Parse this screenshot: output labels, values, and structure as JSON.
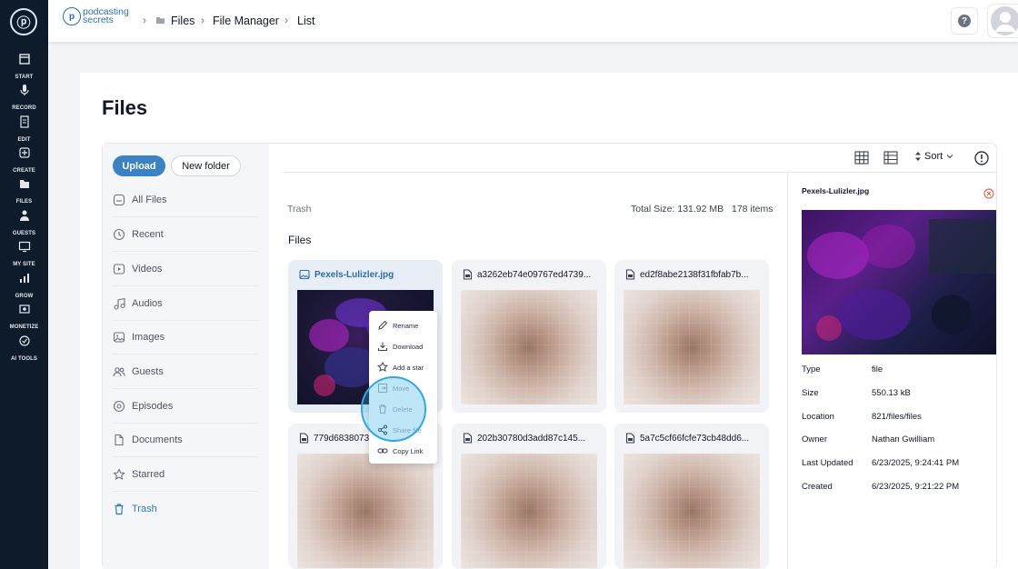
{
  "rail": {
    "items": [
      {
        "label": "START",
        "icon": "start-icon"
      },
      {
        "label": "RECORD",
        "icon": "microphone-icon"
      },
      {
        "label": "EDIT",
        "icon": "edit-icon"
      },
      {
        "label": "CREATE",
        "icon": "create-icon"
      },
      {
        "label": "FILES",
        "icon": "files-icon"
      },
      {
        "label": "GUESTS",
        "icon": "guests-icon"
      },
      {
        "label": "MY SITE",
        "icon": "site-icon"
      },
      {
        "label": "GROW",
        "icon": "grow-icon"
      },
      {
        "label": "MONETIZE",
        "icon": "monetize-icon"
      },
      {
        "label": "AI TOOLS",
        "icon": "ai-tools-icon"
      }
    ]
  },
  "header": {
    "brand_line1": "podcasting",
    "brand_line2": "secrets",
    "breadcrumb": [
      "Files",
      "File Manager",
      "List"
    ],
    "help_glyph": "?"
  },
  "page": {
    "title": "Files"
  },
  "actions": {
    "upload": "Upload",
    "new_folder": "New folder"
  },
  "nav": {
    "items": [
      {
        "label": "All Files"
      },
      {
        "label": "Recent"
      },
      {
        "label": "Videos"
      },
      {
        "label": "Audios"
      },
      {
        "label": "Images"
      },
      {
        "label": "Guests"
      },
      {
        "label": "Episodes"
      },
      {
        "label": "Documents"
      },
      {
        "label": "Starred"
      },
      {
        "label": "Trash"
      }
    ],
    "active": "Trash",
    "accent_color": "#2b7bb9"
  },
  "toolbar": {
    "sort_label": "Sort"
  },
  "listing": {
    "location_label": "Trash",
    "total_size": "Total Size: 131.92 MB",
    "item_count": "178 items",
    "section_title": "Files"
  },
  "files": [
    {
      "name": "Pexels-Lulizler.jpg",
      "type": "image"
    },
    {
      "name": "a3262eb74e09767ed4739...",
      "type": "document"
    },
    {
      "name": "ed2f8abe2138f31fbfab7b...",
      "type": "document"
    },
    {
      "name": "779d6838073",
      "type": "document"
    },
    {
      "name": "202b30780d3add87c145...",
      "type": "document"
    },
    {
      "name": "5a7c5cf66fcfe73cb48dd6...",
      "type": "document"
    }
  ],
  "context_menu": {
    "items": [
      {
        "label": "Rename",
        "icon": "pencil-icon"
      },
      {
        "label": "Download",
        "icon": "download-icon"
      },
      {
        "label": "Add a star",
        "icon": "star-icon"
      },
      {
        "label": "Move",
        "icon": "move-icon"
      },
      {
        "label": "Delete",
        "icon": "trash-icon"
      },
      {
        "label": "Share file",
        "icon": "share-icon"
      },
      {
        "label": "Copy Link",
        "icon": "link-icon"
      }
    ]
  },
  "details": {
    "name": "Pexels-Lulizler.jpg",
    "rows": [
      {
        "key": "Type",
        "value": "file"
      },
      {
        "key": "Size",
        "value": "550.13 kB"
      },
      {
        "key": "Location",
        "value": "821/files/files"
      },
      {
        "key": "Owner",
        "value": "Nathan Gwilliam"
      },
      {
        "key": "Last Updated",
        "value": "6/23/2025, 9:24:41 PM"
      },
      {
        "key": "Created",
        "value": "6/23/2025, 9:21:22 PM"
      }
    ]
  },
  "colors": {
    "rail_bg": "#0d1b2a",
    "primary": "#3b82c4",
    "close": "#e0533e",
    "highlight": "#32a8dd"
  }
}
